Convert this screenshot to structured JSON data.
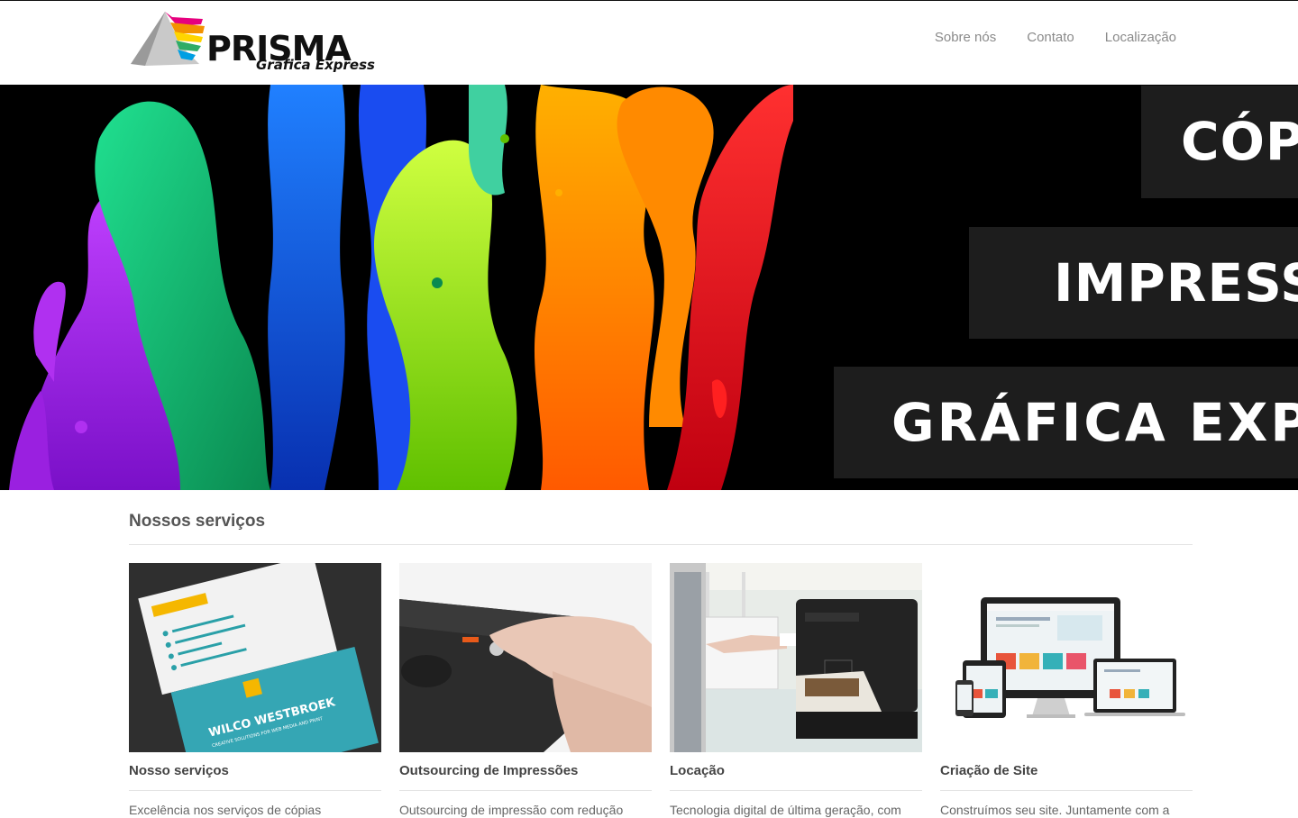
{
  "header": {
    "logo": {
      "name": "PRISMA",
      "tagline": "Gráfica Express"
    },
    "nav": [
      {
        "label": "Sobre nós"
      },
      {
        "label": "Contato"
      },
      {
        "label": "Localização"
      }
    ]
  },
  "hero": {
    "banners": [
      "CÓPIAS",
      "IMPRESSÕES",
      "GRÁFICA EXPRESS"
    ]
  },
  "services": {
    "title": "Nossos serviços",
    "cards": [
      {
        "title": "Nosso serviços",
        "text": "Excelência nos serviços de cópias",
        "card_text": "WILCO WESTBROEK",
        "card_sub": "CREATIVE SOLUTIONS FOR WEB MEDIA AND PRINT"
      },
      {
        "title": "Outsourcing de Impressões",
        "text": "Outsourcing de impressão com redução"
      },
      {
        "title": "Locação",
        "text": "Tecnologia digital de última geração, com"
      },
      {
        "title": "Criação de Site",
        "text": "Construímos seu site. Juntamente com a"
      }
    ]
  }
}
